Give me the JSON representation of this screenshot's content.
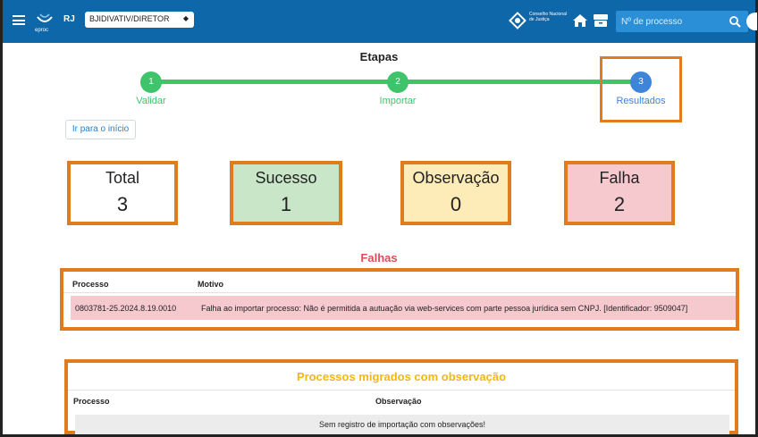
{
  "header": {
    "logo_text": "eproc",
    "state": "RJ",
    "profile": "BJIDIVATIV/DIRETOR",
    "cnj_logo_text": "Conselho Nacional de Justiça",
    "search_placeholder": "Nº de processo"
  },
  "steps": {
    "title": "Etapas",
    "items": [
      {
        "number": "1",
        "label": "Validar"
      },
      {
        "number": "2",
        "label": "Importar"
      },
      {
        "number": "3",
        "label": "Resultados"
      }
    ]
  },
  "restart_label": "Ir para o início",
  "stats": {
    "total": {
      "label": "Total",
      "value": "3"
    },
    "success": {
      "label": "Sucesso",
      "value": "1"
    },
    "observation": {
      "label": "Observação",
      "value": "0"
    },
    "failure": {
      "label": "Falha",
      "value": "2"
    }
  },
  "failures": {
    "title": "Falhas",
    "col_process": "Processo",
    "col_reason": "Motivo",
    "rows": [
      {
        "process": "0803781-25.2024.8.19.0010",
        "reason": "Falha ao importar processo: Não é permitida a autuação via web-services com parte pessoa jurídica sem CNPJ. [Identificador: 9509047]"
      }
    ]
  },
  "observations": {
    "title": "Processos migrados com observação",
    "col_process": "Processo",
    "col_observation": "Observação",
    "empty_message": "Sem registro de importação com observações!"
  },
  "colors": {
    "topbar": "#0d67a8",
    "step_done": "#3fc36b",
    "step_current": "#3e84d8",
    "highlight": "#e07c1c",
    "success_bg": "#c9e6c9",
    "observation_bg": "#fdebb8",
    "failure_bg": "#f6c9cf"
  }
}
